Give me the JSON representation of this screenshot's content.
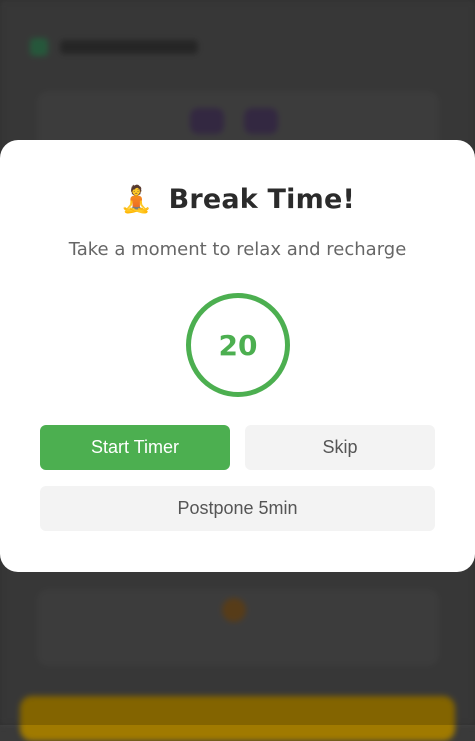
{
  "modal": {
    "icon": "🧘",
    "title": "Break Time!",
    "subtitle": "Take a moment to relax and recharge",
    "timer_value": "20",
    "buttons": {
      "start": "Start Timer",
      "skip": "Skip",
      "postpone": "Postpone 5min"
    }
  },
  "colors": {
    "accent": "#4caf50",
    "secondary_button": "#f3f3f3",
    "overlay": "#3a3a3a"
  }
}
